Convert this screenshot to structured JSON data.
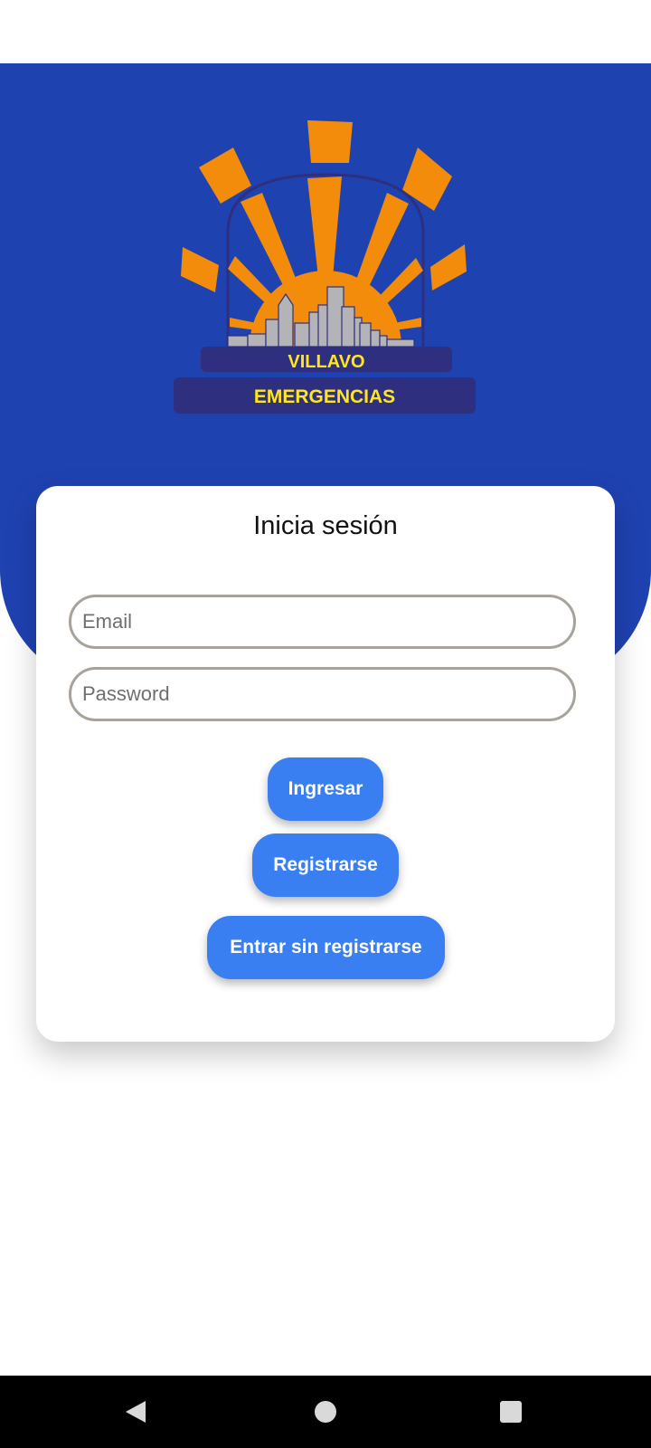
{
  "logo": {
    "line1": "VILLAVO",
    "line2": "EMERGENCIAS",
    "colors": {
      "rays": "#f28c0a",
      "text": "#ffe61e",
      "banner": "#2e2f7e",
      "buildings": "#b4b4b8"
    }
  },
  "login": {
    "title": "Inicia sesión",
    "email": {
      "placeholder": "Email",
      "value": ""
    },
    "password": {
      "placeholder": "Password",
      "value": ""
    },
    "login_label": "Ingresar",
    "register_label": "Registrarse",
    "guest_label": "Entrar sin registrarse"
  },
  "nav": {
    "back_icon": "triangle-back-icon",
    "home_icon": "circle-home-icon",
    "recent_icon": "square-recent-icon"
  },
  "colors": {
    "hero": "#1f42b1",
    "button": "#3a7ff2",
    "field_border": "#a8a29b"
  }
}
